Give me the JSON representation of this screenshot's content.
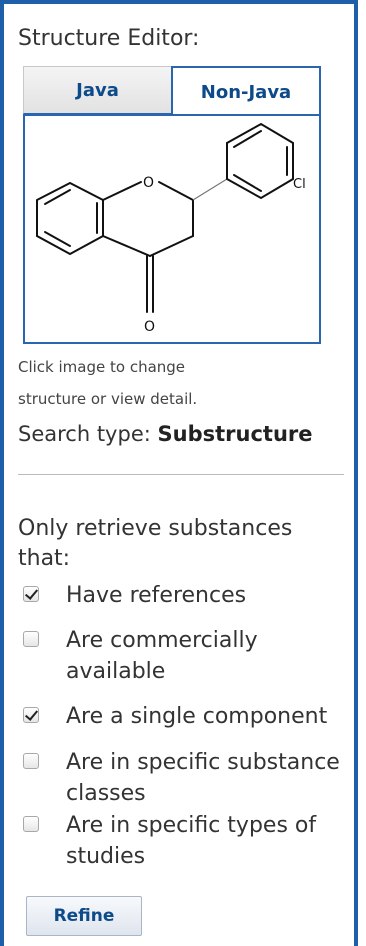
{
  "editor": {
    "title": "Structure Editor:",
    "tabs": [
      {
        "label": "Java",
        "active": false
      },
      {
        "label": "Non-Java",
        "active": true
      }
    ],
    "structure_atom_labels": {
      "oxygen_ring": "O",
      "oxygen_carbonyl": "O",
      "chlorine": "Cl"
    },
    "hint_line1": "Click image to change",
    "hint_line2": "structure or view detail.",
    "search_type_label": "Search type:",
    "search_type_value": "Substructure"
  },
  "filters": {
    "title": "Only retrieve substances that:",
    "options": [
      {
        "label": "Have references",
        "checked": true
      },
      {
        "label": "Are commercially available",
        "checked": false
      },
      {
        "label": "Are a single component",
        "checked": true
      },
      {
        "label": "Are in specific substance classes",
        "checked": false
      },
      {
        "label": "Are in specific types of studies",
        "checked": false
      }
    ]
  },
  "actions": {
    "refine_label": "Refine"
  },
  "colors": {
    "panel_border": "#1f5ea8",
    "tab_text": "#0d4a8a"
  }
}
